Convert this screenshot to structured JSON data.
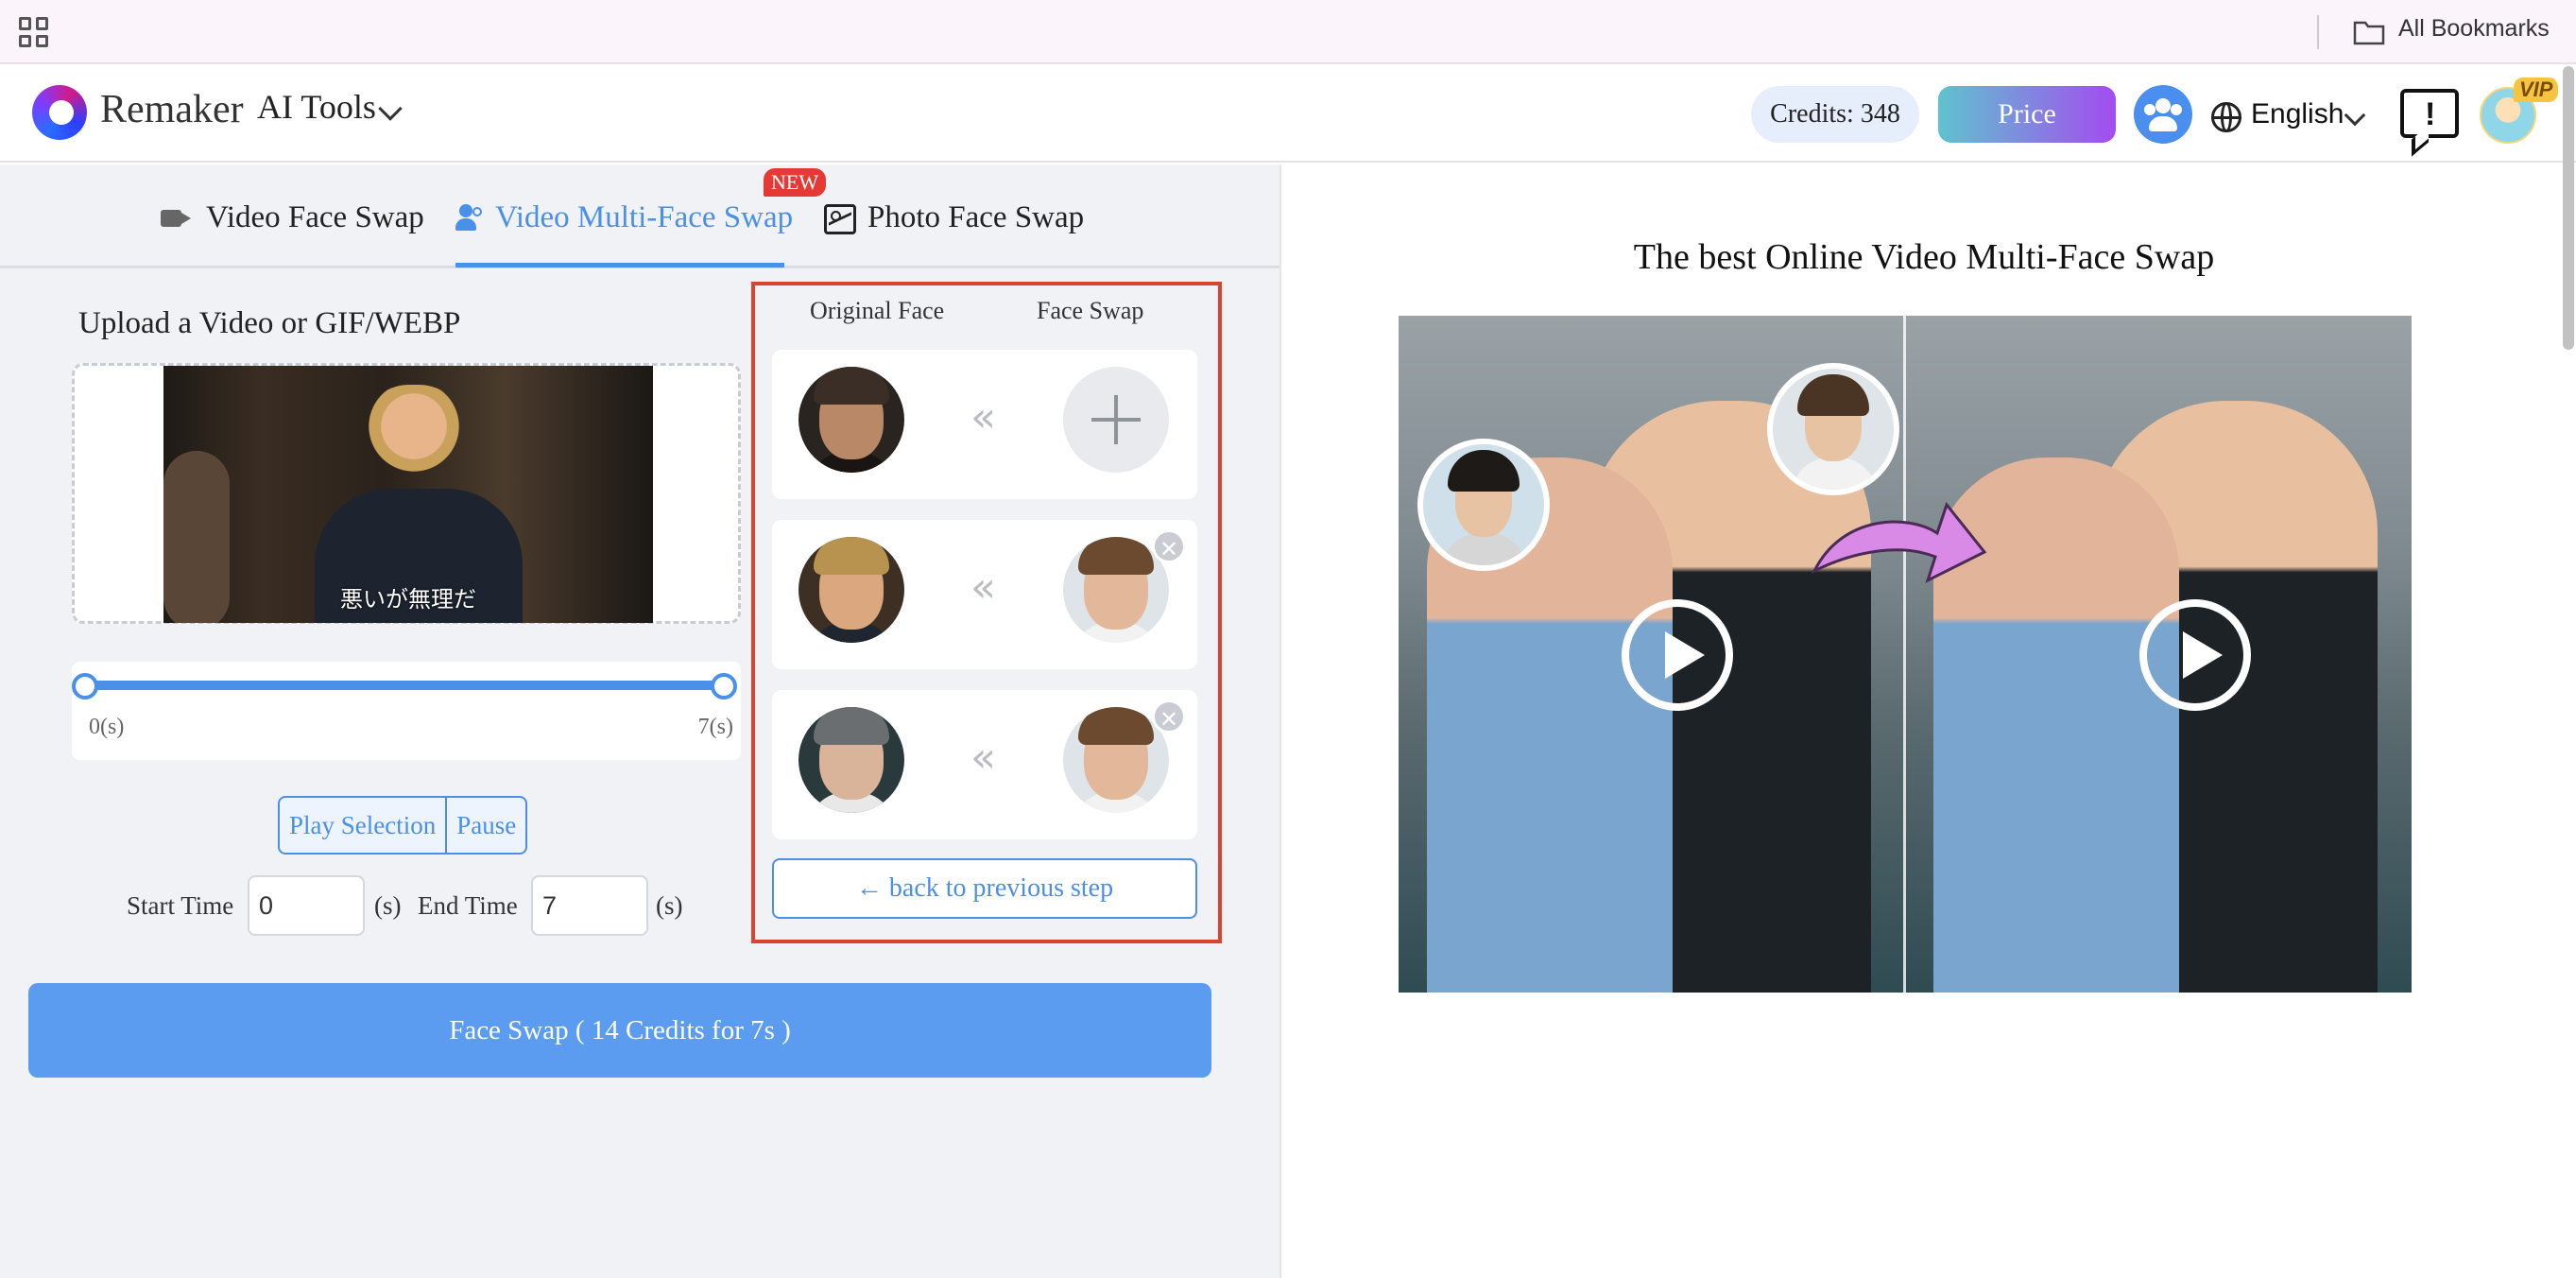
{
  "browser": {
    "bookmarks_label": "All Bookmarks"
  },
  "header": {
    "brand": "Remaker",
    "ai_tools": "AI Tools",
    "credits": "Credits: 348",
    "price": "Price",
    "language": "English",
    "vip": "VIP",
    "feedback_glyph": "!"
  },
  "tabs": [
    {
      "label": "Video Face Swap",
      "icon": "video-camera-icon"
    },
    {
      "label": "Video Multi-Face Swap",
      "icon": "users-icon",
      "active": true,
      "badge": "NEW"
    },
    {
      "label": "Photo Face Swap",
      "icon": "image-icon"
    }
  ],
  "upload": {
    "title": "Upload a Video or GIF/WEBP",
    "subtitle": "悪いが無理だ"
  },
  "slider": {
    "start_label": "0(s)",
    "end_label": "7(s)",
    "selection": [
      0,
      7
    ]
  },
  "playback": {
    "play_selection": "Play Selection",
    "pause": "Pause"
  },
  "time": {
    "start_label": "Start Time",
    "start_value": "0",
    "end_label": "End Time",
    "end_value": "7",
    "unit": "(s)"
  },
  "action": {
    "face_swap": "Face Swap ( 14 Credits for 7s )"
  },
  "faces": {
    "original_header": "Original Face",
    "swap_header": "Face Swap",
    "arrow_glyph": "«",
    "remove_glyph": "✕",
    "back": "← back to previous step"
  },
  "right": {
    "title": "The best Online Video Multi-Face Swap"
  },
  "colors": {
    "accent": "#4a8fe8",
    "primary_button": "#5b9cf1",
    "highlight_border": "#d9432f",
    "new_badge": "#e53935"
  }
}
